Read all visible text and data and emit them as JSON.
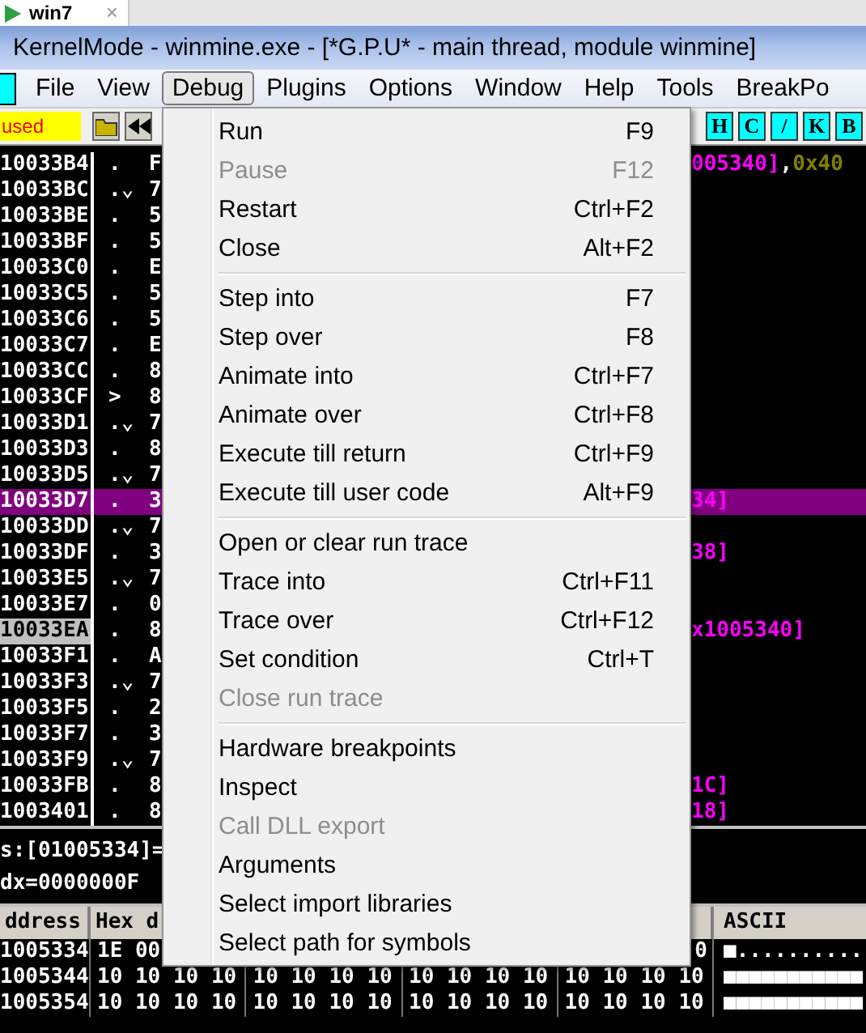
{
  "browser_tab": {
    "label": "win7",
    "close": "×"
  },
  "window": {
    "title": "KernelMode - winmine.exe - [*G.P.U* - main thread, module winmine]"
  },
  "menu_bar": [
    {
      "label": "File",
      "selected": false
    },
    {
      "label": "View",
      "selected": false
    },
    {
      "label": "Debug",
      "selected": true
    },
    {
      "label": "Plugins",
      "selected": false
    },
    {
      "label": "Options",
      "selected": false
    },
    {
      "label": "Window",
      "selected": false
    },
    {
      "label": "Help",
      "selected": false
    },
    {
      "label": "Tools",
      "selected": false
    },
    {
      "label": "BreakPo",
      "selected": false
    }
  ],
  "toolbar": {
    "status": "used",
    "letter_buttons": [
      "H",
      "C",
      "/",
      "K",
      "B"
    ]
  },
  "disassembly": {
    "rows": [
      {
        "address": "10033B4",
        "mark": ".",
        "hex": "F",
        "selected": false,
        "current": false,
        "comment": [
          {
            "kind": "operand",
            "text": "005340]"
          },
          {
            "kind": "punct",
            "text": ","
          },
          {
            "kind": "number",
            "text": "0x40"
          }
        ]
      },
      {
        "address": "10033BC",
        "mark": ".⌄",
        "hex": "7",
        "selected": false,
        "current": false
      },
      {
        "address": "10033BE",
        "mark": ".",
        "hex": "5",
        "selected": false,
        "current": false
      },
      {
        "address": "10033BF",
        "mark": ".",
        "hex": "5",
        "selected": false,
        "current": false
      },
      {
        "address": "10033C0",
        "mark": ".",
        "hex": "E",
        "selected": false,
        "current": false
      },
      {
        "address": "10033C5",
        "mark": ".",
        "hex": "5",
        "selected": false,
        "current": false
      },
      {
        "address": "10033C6",
        "mark": ".",
        "hex": "5",
        "selected": false,
        "current": false
      },
      {
        "address": "10033C7",
        "mark": ".",
        "hex": "E",
        "selected": false,
        "current": false
      },
      {
        "address": "10033CC",
        "mark": ".",
        "hex": "8",
        "selected": false,
        "current": false
      },
      {
        "address": "10033CF",
        "mark": ">",
        "hex": "8",
        "selected": false,
        "current": false
      },
      {
        "address": "10033D1",
        "mark": ".⌄",
        "hex": "7",
        "selected": false,
        "current": false
      },
      {
        "address": "10033D3",
        "mark": ".",
        "hex": "8",
        "selected": false,
        "current": false
      },
      {
        "address": "10033D5",
        "mark": ".⌄",
        "hex": "7",
        "selected": false,
        "current": false
      },
      {
        "address": "10033D7",
        "mark": ".",
        "hex": "3",
        "selected": true,
        "current": false,
        "comment": [
          {
            "kind": "operand",
            "text": "34]"
          }
        ]
      },
      {
        "address": "10033DD",
        "mark": ".⌄",
        "hex": "7",
        "selected": false,
        "current": false
      },
      {
        "address": "10033DF",
        "mark": ".",
        "hex": "3",
        "selected": false,
        "current": false,
        "comment": [
          {
            "kind": "operand",
            "text": "38]"
          }
        ]
      },
      {
        "address": "10033E5",
        "mark": ".⌄",
        "hex": "7",
        "selected": false,
        "current": false
      },
      {
        "address": "10033E7",
        "mark": ".",
        "hex": "0",
        "selected": false,
        "current": false
      },
      {
        "address": "10033EA",
        "mark": ".",
        "hex": "8",
        "selected": false,
        "current": true,
        "comment": [
          {
            "kind": "operand",
            "text": "x1005340]"
          }
        ]
      },
      {
        "address": "10033F1",
        "mark": ".",
        "hex": "A",
        "selected": false,
        "current": false
      },
      {
        "address": "10033F3",
        "mark": ".⌄",
        "hex": "7",
        "selected": false,
        "current": false
      },
      {
        "address": "10033F5",
        "mark": ".",
        "hex": "2",
        "selected": false,
        "current": false
      },
      {
        "address": "10033F7",
        "mark": ".",
        "hex": "3",
        "selected": false,
        "current": false
      },
      {
        "address": "10033F9",
        "mark": ".⌄",
        "hex": "7",
        "selected": false,
        "current": false
      },
      {
        "address": "10033FB",
        "mark": ".",
        "hex": "8",
        "selected": false,
        "current": false,
        "comment": [
          {
            "kind": "operand",
            "text": "1C]"
          }
        ]
      },
      {
        "address": "1003401",
        "mark": ".",
        "hex": "8",
        "selected": false,
        "current": false,
        "comment": [
          {
            "kind": "operand",
            "text": "18]"
          }
        ]
      }
    ]
  },
  "info_pane": {
    "lines": [
      "s:[01005334]=",
      "dx=0000000F"
    ]
  },
  "dump": {
    "columns": [
      "ddress",
      "Hex d",
      "ASCII"
    ],
    "rows": [
      {
        "address": "1005334",
        "hex_start": "1E 00",
        "hex_end": "0",
        "ascii": "■.........."
      },
      {
        "address": "1005344",
        "hex_groups": [
          "10 10 10 10",
          "10 10 10 10",
          "10 10 10 10",
          "10 10 10 10"
        ],
        "ascii": "■■■■■■■■■■■"
      },
      {
        "address": "1005354",
        "hex_groups": [
          "10 10 10 10",
          "10 10 10 10",
          "10 10 10 10",
          "10 10 10 10"
        ],
        "ascii": "■■■■■■■■■■■"
      }
    ]
  },
  "debug_menu": {
    "groups": [
      [
        {
          "label": "Run",
          "shortcut": "F9",
          "disabled": false
        },
        {
          "label": "Pause",
          "shortcut": "F12",
          "disabled": true
        },
        {
          "label": "Restart",
          "shortcut": "Ctrl+F2",
          "disabled": false
        },
        {
          "label": "Close",
          "shortcut": "Alt+F2",
          "disabled": false
        }
      ],
      [
        {
          "label": "Step into",
          "shortcut": "F7",
          "disabled": false
        },
        {
          "label": "Step over",
          "shortcut": "F8",
          "disabled": false
        },
        {
          "label": "Animate into",
          "shortcut": "Ctrl+F7",
          "disabled": false
        },
        {
          "label": "Animate over",
          "shortcut": "Ctrl+F8",
          "disabled": false
        },
        {
          "label": "Execute till return",
          "shortcut": "Ctrl+F9",
          "disabled": false
        },
        {
          "label": "Execute till user code",
          "shortcut": "Alt+F9",
          "disabled": false
        }
      ],
      [
        {
          "label": "Open or clear run trace",
          "disabled": false
        },
        {
          "label": "Trace into",
          "shortcut": "Ctrl+F11",
          "disabled": false
        },
        {
          "label": "Trace over",
          "shortcut": "Ctrl+F12",
          "disabled": false
        },
        {
          "label": "Set condition",
          "shortcut": "Ctrl+T",
          "disabled": false
        },
        {
          "label": "Close run trace",
          "disabled": true
        }
      ],
      [
        {
          "label": "Hardware breakpoints",
          "disabled": false
        },
        {
          "label": "Inspect",
          "disabled": false
        },
        {
          "label": "Call DLL export",
          "disabled": true
        },
        {
          "label": "Arguments",
          "disabled": false
        },
        {
          "label": "Select import libraries",
          "disabled": false
        },
        {
          "label": "Select path for symbols",
          "disabled": false
        }
      ]
    ]
  }
}
